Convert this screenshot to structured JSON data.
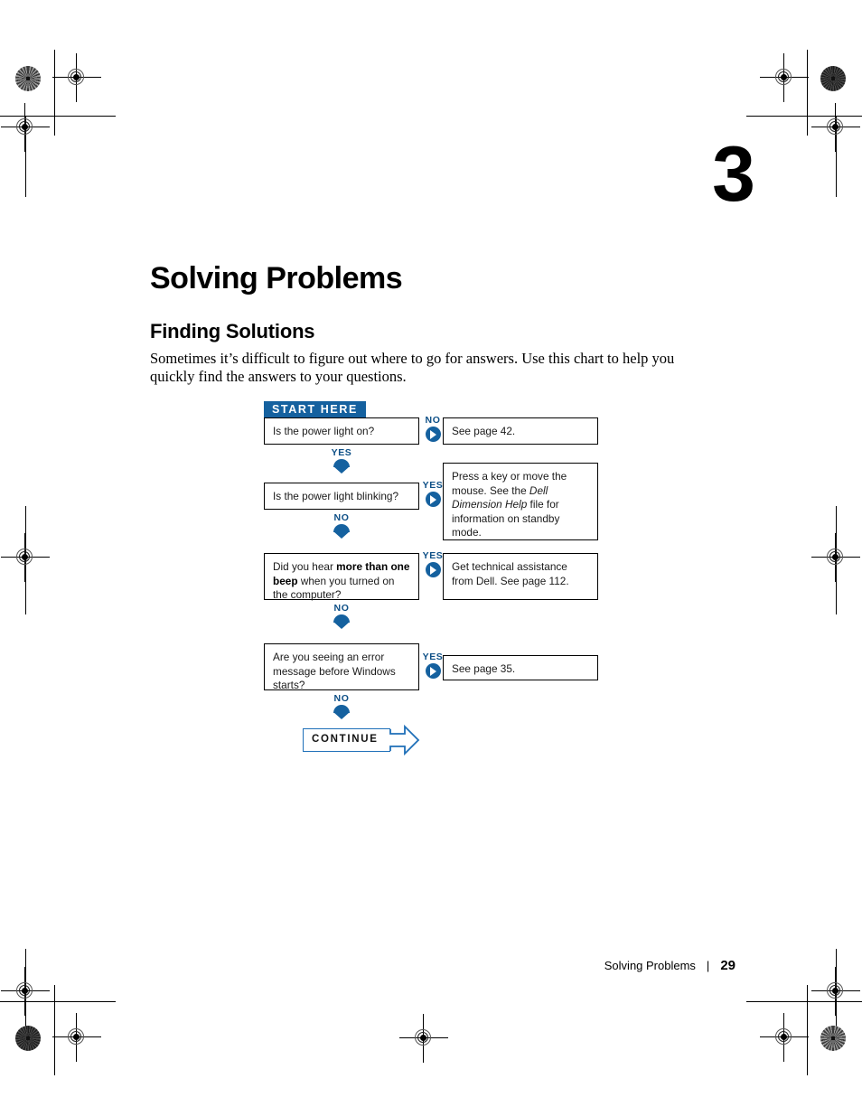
{
  "document": {
    "chapter_number": "3",
    "chapter_title": "Solving Problems",
    "section_title": "Finding Solutions",
    "intro_paragraph": "Sometimes it’s difficult to figure out where to go for answers. Use this chart to help you quickly find the answers to your questions."
  },
  "flowchart": {
    "start_banner": "START HERE",
    "continue_label": "CONTINUE",
    "accent_color": "#15619F",
    "steps": [
      {
        "question": "Is the power light on?",
        "branch_label": "NO",
        "answer": "See page 42.",
        "next_label": "YES"
      },
      {
        "question": "Is the power light blinking?",
        "branch_label": "YES",
        "answer_prefix": "Press a key or move the mouse. See the ",
        "answer_italic": "Dell Dimension Help",
        "answer_suffix": " file for information on standby mode.",
        "next_label": "NO"
      },
      {
        "question_prefix": "Did you hear ",
        "question_bold": "more than one beep",
        "question_suffix": " when you turned on the computer?",
        "branch_label": "YES",
        "answer": "Get technical assistance from Dell. See page 112.",
        "next_label": "NO"
      },
      {
        "question": "Are you seeing an error message before Windows starts?",
        "branch_label": "YES",
        "answer": "See page 35.",
        "next_label": "NO"
      }
    ]
  },
  "footer": {
    "running_head": "Solving Problems",
    "separator": "|",
    "page_number": "29"
  }
}
